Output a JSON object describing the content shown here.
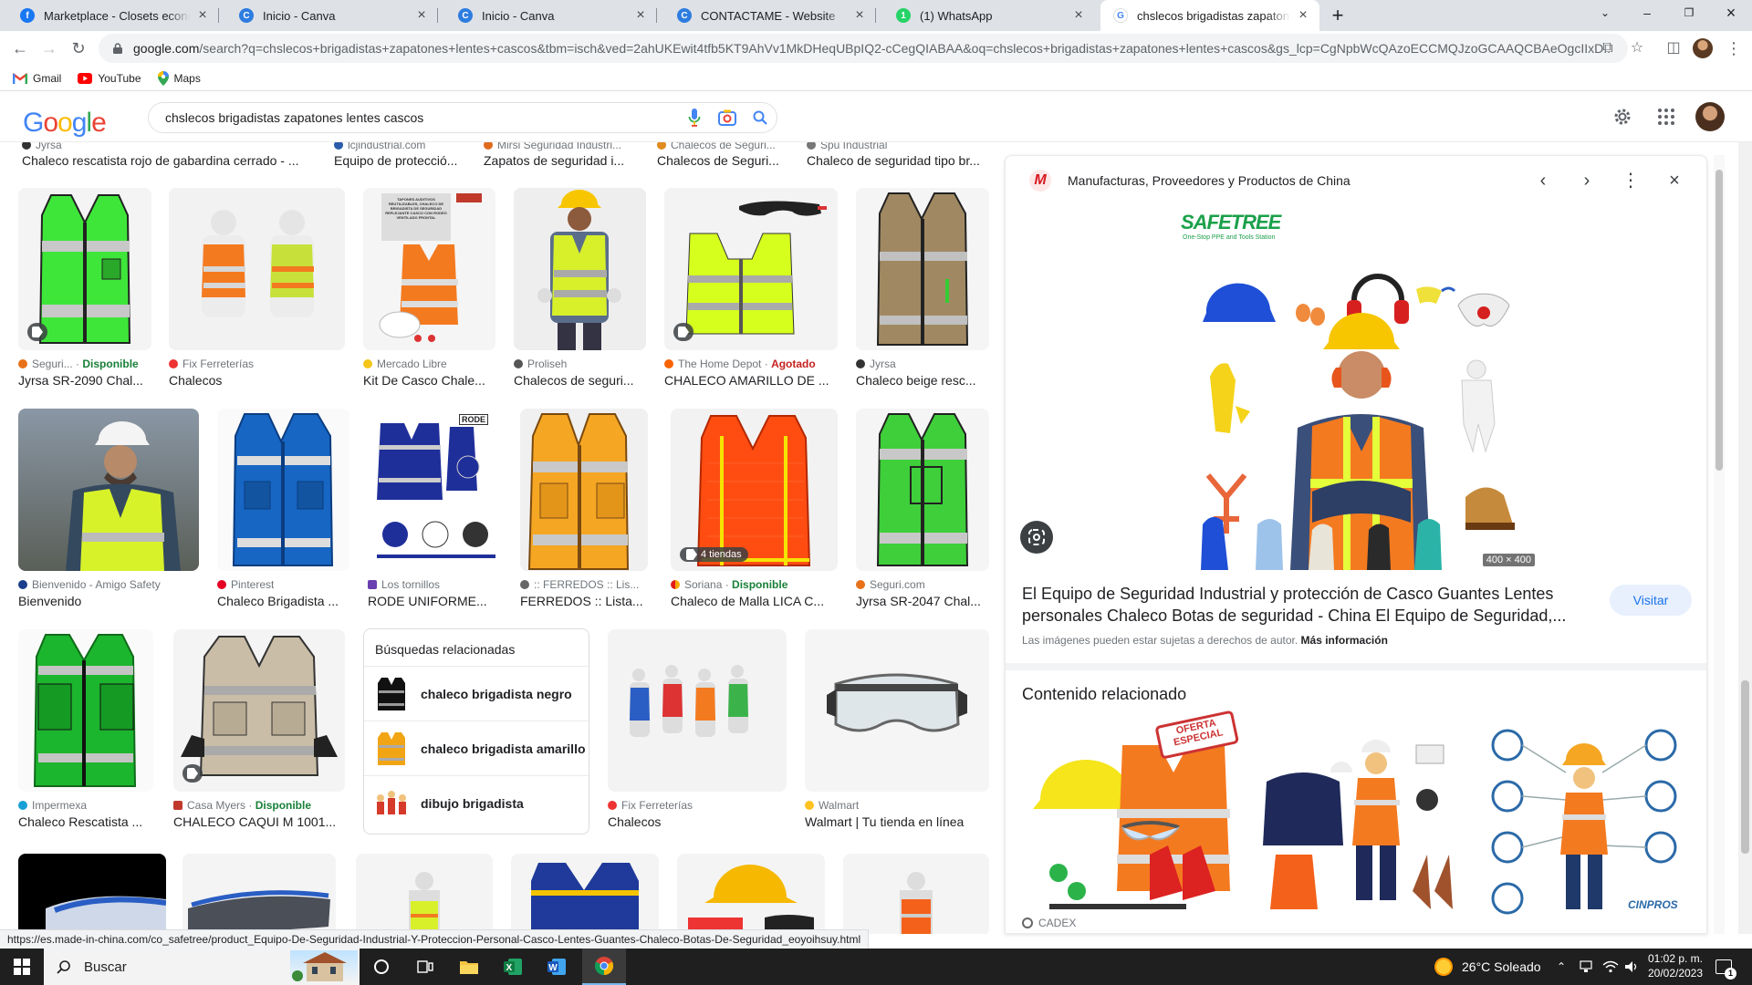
{
  "browser": {
    "tabs": [
      {
        "title": "Marketplace - Closets económicos",
        "icon": "facebook-icon",
        "color": "#1877f2",
        "glyph": "f"
      },
      {
        "title": "Inicio - Canva",
        "icon": "canva-icon",
        "color": "#2d7de0",
        "glyph": "C"
      },
      {
        "title": "Inicio - Canva",
        "icon": "canva-icon",
        "color": "#2d7de0",
        "glyph": "C"
      },
      {
        "title": "CONTACTAME - Website",
        "icon": "canva-icon",
        "color": "#2d7de0",
        "glyph": "C"
      },
      {
        "title": "(1) WhatsApp",
        "icon": "whatsapp-icon",
        "color": "#25d366",
        "glyph": "1"
      },
      {
        "title": "chslecos brigadistas zapatones le",
        "icon": "google-icon",
        "color": "#ffffff",
        "glyph": "G"
      }
    ],
    "url_host": "google.com",
    "url_path": "/search?q=chslecos+brigadistas+zapatones+lentes+cascos&tbm=isch&ved=2ahUKEwit4tfb5KT9AhVv1MkDHeqUBpIQ2-cCegQIABAA&oq=chslecos+brigadistas+zapatones+lentes+cascos&gs_lcp=CgNpbWcQAzoECCMQJzoGCAAQCBAeOgcIIxD...",
    "bookmarks": [
      {
        "label": "Gmail",
        "icon": "gmail-icon"
      },
      {
        "label": "YouTube",
        "icon": "youtube-icon"
      },
      {
        "label": "Maps",
        "icon": "maps-icon"
      }
    ]
  },
  "google": {
    "logo": "Google",
    "query": "chslecos brigadistas zapatones lentes cascos"
  },
  "results": {
    "top_row": [
      {
        "src": "Jyrsa",
        "title": "Chaleco rescatista rojo de gabardina cerrado - ..."
      },
      {
        "src": "lcjindustrial.com",
        "title": "Equipo de protecció..."
      },
      {
        "src": "Mirsi Seguridad Industri...",
        "title": "Zapatos de seguridad i..."
      },
      {
        "src": "Chalecos de Seguri...",
        "title": "Chalecos de Seguri..."
      },
      {
        "src": "Spu Industrial",
        "title": "Chaleco de seguridad tipo br..."
      }
    ],
    "row1": [
      {
        "src": "Seguri...",
        "status": "Disponible",
        "title": "Jyrsa SR-2090 Chal..."
      },
      {
        "src": "Fix Ferreterías",
        "status": "",
        "title": "Chalecos"
      },
      {
        "src": "Mercado Libre",
        "status": "",
        "title": "Kit De Casco Chale..."
      },
      {
        "src": "Proliseh",
        "status": "",
        "title": "Chalecos de seguri..."
      },
      {
        "src": "The Home Depot",
        "status": "Agotado",
        "title": "CHALECO AMARILLO DE ..."
      },
      {
        "src": "Jyrsa",
        "status": "",
        "title": "Chaleco beige resc..."
      }
    ],
    "row2": [
      {
        "src": "Bienvenido - Amigo Safety",
        "status": "",
        "title": "Bienvenido"
      },
      {
        "src": "Pinterest",
        "status": "",
        "title": "Chaleco Brigadista ..."
      },
      {
        "src": "Los tornillos",
        "status": "",
        "title": "RODE UNIFORME..."
      },
      {
        "src": ":: FERREDOS :: Lis...",
        "status": "",
        "title": "FERREDOS :: Lista..."
      },
      {
        "src": "Soriana",
        "status": "Disponible",
        "title": "Chaleco de Malla LICA C..."
      },
      {
        "src": "Seguri.com",
        "status": "",
        "title": "Jyrsa SR-2047 Chal..."
      }
    ],
    "row3": [
      {
        "src": "Impermexa",
        "status": "",
        "title": "Chaleco Rescatista ..."
      },
      {
        "src": "Casa Myers",
        "status": "Disponible",
        "title": "CHALECO CAQUI M 1001..."
      },
      {
        "src": "Fix Ferreterías",
        "status": "",
        "title": "Chalecos"
      },
      {
        "src": "Walmart",
        "status": "",
        "title": "Walmart | Tu tienda en línea"
      }
    ],
    "stores_badge": "4 tiendas",
    "rode_label": "RODE",
    "kit_note": "TAPONES AUDITIVOS REUTILIZABLES, CHALECO DE BRIGADISTA DE SEGURIDAD REFLEJANTE CASCO CON RODEO VENTILADO FRONTAL",
    "related": {
      "heading": "Búsquedas relacionadas",
      "items": [
        "chaleco brigadista negro",
        "chaleco brigadista amarillo",
        "dibujo brigadista"
      ]
    }
  },
  "panel": {
    "source": "Manufacturas, Proveedores y Productos de China",
    "brand": "SAFETREE",
    "brand_tagline": "One-Stop PPE and Tools Station",
    "dims": "400 × 400",
    "title": "El Equipo de Seguridad Industrial y protección de Casco Guantes Lentes personales Chaleco Botas de seguridad - China El Equipo de Seguridad,...",
    "visit": "Visitar",
    "copyright": "Las imágenes pueden estar sujetas a derechos de autor.",
    "more_info": "Más información",
    "related_heading": "Contenido relacionado",
    "related_source": "CADEX",
    "offer_label": "OFERTA ESPECIAL",
    "cinpros_label": "CINPROS"
  },
  "status_url": "https://es.made-in-china.com/co_safetree/product_Equipo-De-Seguridad-Industrial-Y-Proteccion-Personal-Casco-Lentes-Guantes-Chaleco-Botas-De-Seguridad_eoyoihsuy.html",
  "taskbar": {
    "search_placeholder": "Buscar",
    "weather": "26°C  Soleado",
    "time": "01:02 p. m.",
    "date": "20/02/2023",
    "notifications": "1"
  }
}
